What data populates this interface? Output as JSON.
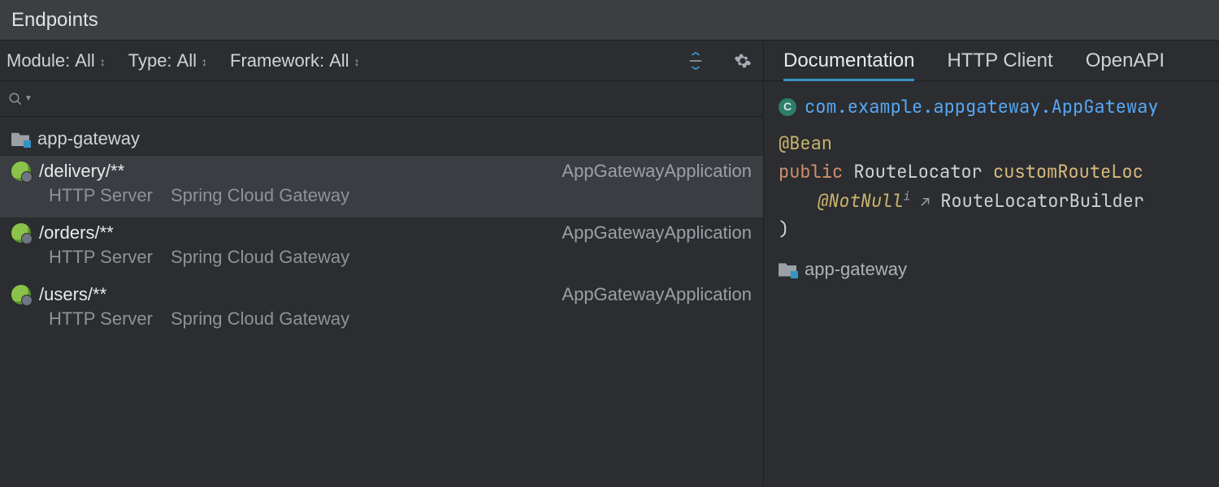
{
  "title": "Endpoints",
  "filters": {
    "module_label": "Module:",
    "module_value": "All",
    "type_label": "Type:",
    "type_value": "All",
    "framework_label": "Framework:",
    "framework_value": "All"
  },
  "search": {
    "placeholder": ""
  },
  "group": {
    "name": "app-gateway"
  },
  "endpoints": [
    {
      "path": "/delivery/**",
      "class": "AppGatewayApplication",
      "server": "HTTP Server",
      "framework": "Spring Cloud Gateway",
      "selected": true
    },
    {
      "path": "/orders/**",
      "class": "AppGatewayApplication",
      "server": "HTTP Server",
      "framework": "Spring Cloud Gateway",
      "selected": false
    },
    {
      "path": "/users/**",
      "class": "AppGatewayApplication",
      "server": "HTTP Server",
      "framework": "Spring Cloud Gateway",
      "selected": false
    }
  ],
  "right": {
    "tabs": [
      "Documentation",
      "HTTP Client",
      "OpenAPI"
    ],
    "active_tab": 0,
    "class_badge": "C",
    "fqcn": "com.example.appgateway.AppGateway",
    "code": {
      "anno": "@Bean",
      "modifier": "public",
      "return_type": "RouteLocator",
      "method": "customRouteLoc",
      "param_anno": "@NotNull",
      "sup": "i",
      "arrow": "↗",
      "param_type": "RouteLocatorBuilder",
      "close": ")"
    },
    "module": "app-gateway"
  }
}
